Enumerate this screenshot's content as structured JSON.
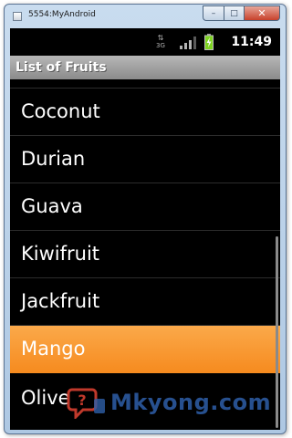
{
  "window": {
    "title": "5554:MyAndroid",
    "minimize_glyph": "–",
    "maximize_glyph": "□",
    "close_glyph": "✕"
  },
  "statusbar": {
    "network_label": "3G",
    "time": "11:49"
  },
  "app": {
    "title": "List of Fruits"
  },
  "list": {
    "items": [
      {
        "label": ""
      },
      {
        "label": "Coconut"
      },
      {
        "label": "Durian"
      },
      {
        "label": "Guava"
      },
      {
        "label": "Kiwifruit"
      },
      {
        "label": "Jackfruit"
      },
      {
        "label": "Mango"
      },
      {
        "label": "Olive"
      }
    ],
    "selected": "Mango"
  },
  "watermark": {
    "text": "Mkyong.com"
  },
  "colors": {
    "selection": "#f68b1f",
    "app_title_bar": "#9a9a9a",
    "screen_bg": "#000000",
    "watermark_blue": "#2e5fa8",
    "watermark_red": "#c0392b",
    "battery_green": "#7ed321"
  },
  "icons": {
    "app": "window-app-icon",
    "network": "network-3g-icon",
    "signal": "signal-strength-icon",
    "battery": "battery-charging-icon",
    "watermark_logo": "mkyong-logo-icon"
  }
}
